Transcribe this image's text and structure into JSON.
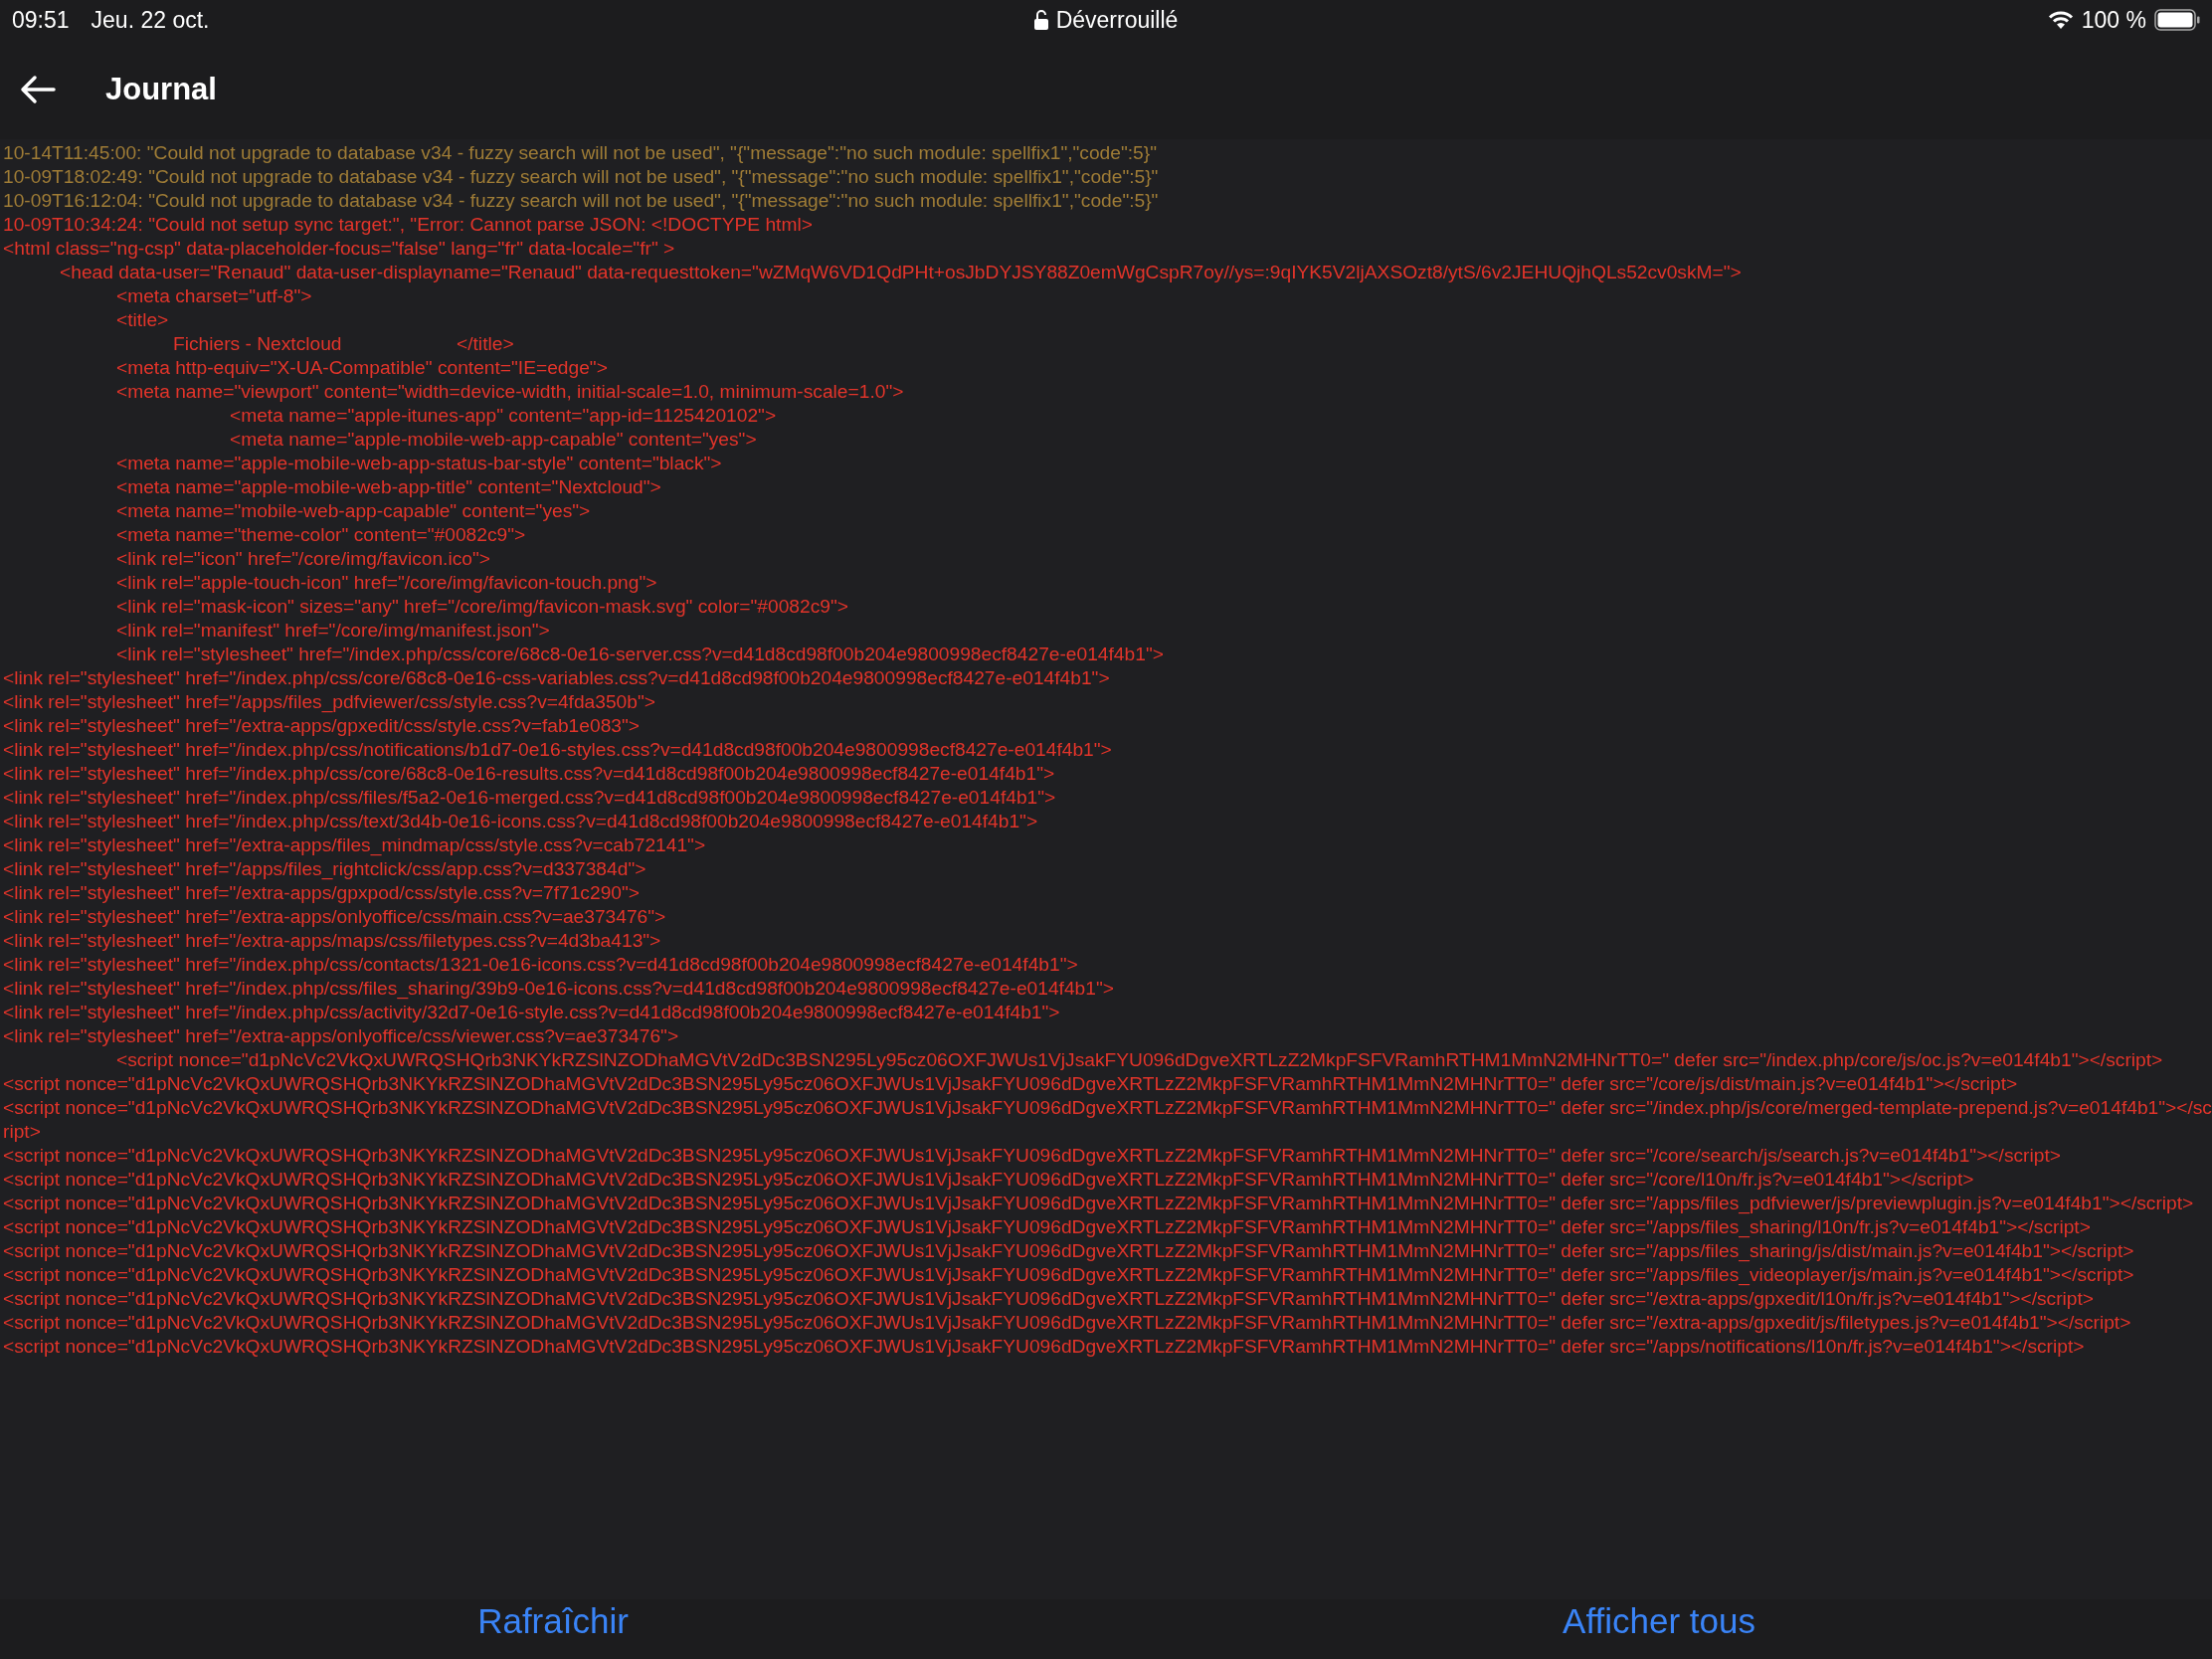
{
  "status_bar": {
    "time": "09:51",
    "date": "Jeu. 22 oct.",
    "lock_label": "Déverrouillé",
    "battery": "100 %"
  },
  "nav": {
    "title": "Journal"
  },
  "log": {
    "lines": [
      {
        "kind": "warning",
        "text": "10-14T11:45:00: \"Could not upgrade to database v34 - fuzzy search will not be used\", \"{\"message\":\"no such module: spellfix1\",\"code\":5}\""
      },
      {
        "kind": "warning",
        "text": "10-09T18:02:49: \"Could not upgrade to database v34 - fuzzy search will not be used\", \"{\"message\":\"no such module: spellfix1\",\"code\":5}\""
      },
      {
        "kind": "warning",
        "text": "10-09T16:12:04: \"Could not upgrade to database v34 - fuzzy search will not be used\", \"{\"message\":\"no such module: spellfix1\",\"code\":5}\""
      },
      {
        "kind": "error",
        "text": "10-09T10:34:24: \"Could not setup sync target:\", \"Error: Cannot parse JSON: <!DOCTYPE html>"
      },
      {
        "kind": "error",
        "text": "<html class=\"ng-csp\" data-placeholder-focus=\"false\" lang=\"fr\" data-locale=\"fr\" >"
      },
      {
        "kind": "error",
        "text": "\t<head data-user=\"Renaud\" data-user-displayname=\"Renaud\" data-requesttoken=\"wZMqW6VD1QdPHt+osJbDYJSY88Z0emWgCspR7oy//ys=:9qIYK5V2ljAXSOzt8/ytS/6v2JEHUQjhQLs52cv0skM=\">"
      },
      {
        "kind": "error",
        "text": "\t\t<meta charset=\"utf-8\">"
      },
      {
        "kind": "error",
        "text": "\t\t<title>"
      },
      {
        "kind": "error",
        "text": "\t\t\tFichiers - Nextcloud\t\t</title>"
      },
      {
        "kind": "error",
        "text": "\t\t<meta http-equiv=\"X-UA-Compatible\" content=\"IE=edge\">"
      },
      {
        "kind": "error",
        "text": "\t\t<meta name=\"viewport\" content=\"width=device-width, initial-scale=1.0, minimum-scale=1.0\">"
      },
      {
        "kind": "error",
        "text": "\t\t\t\t<meta name=\"apple-itunes-app\" content=\"app-id=1125420102\">"
      },
      {
        "kind": "error",
        "text": "\t\t\t\t<meta name=\"apple-mobile-web-app-capable\" content=\"yes\">"
      },
      {
        "kind": "error",
        "text": "\t\t<meta name=\"apple-mobile-web-app-status-bar-style\" content=\"black\">"
      },
      {
        "kind": "error",
        "text": "\t\t<meta name=\"apple-mobile-web-app-title\" content=\"Nextcloud\">"
      },
      {
        "kind": "error",
        "text": "\t\t<meta name=\"mobile-web-app-capable\" content=\"yes\">"
      },
      {
        "kind": "error",
        "text": "\t\t<meta name=\"theme-color\" content=\"#0082c9\">"
      },
      {
        "kind": "error",
        "text": "\t\t<link rel=\"icon\" href=\"/core/img/favicon.ico\">"
      },
      {
        "kind": "error",
        "text": "\t\t<link rel=\"apple-touch-icon\" href=\"/core/img/favicon-touch.png\">"
      },
      {
        "kind": "error",
        "text": "\t\t<link rel=\"mask-icon\" sizes=\"any\" href=\"/core/img/favicon-mask.svg\" color=\"#0082c9\">"
      },
      {
        "kind": "error",
        "text": "\t\t<link rel=\"manifest\" href=\"/core/img/manifest.json\">"
      },
      {
        "kind": "error",
        "text": "\t\t<link rel=\"stylesheet\" href=\"/index.php/css/core/68c8-0e16-server.css?v=d41d8cd98f00b204e9800998ecf8427e-e014f4b1\">"
      },
      {
        "kind": "error",
        "text": "<link rel=\"stylesheet\" href=\"/index.php/css/core/68c8-0e16-css-variables.css?v=d41d8cd98f00b204e9800998ecf8427e-e014f4b1\">"
      },
      {
        "kind": "error",
        "text": "<link rel=\"stylesheet\" href=\"/apps/files_pdfviewer/css/style.css?v=4fda350b\">"
      },
      {
        "kind": "error",
        "text": "<link rel=\"stylesheet\" href=\"/extra-apps/gpxedit/css/style.css?v=fab1e083\">"
      },
      {
        "kind": "error",
        "text": "<link rel=\"stylesheet\" href=\"/index.php/css/notifications/b1d7-0e16-styles.css?v=d41d8cd98f00b204e9800998ecf8427e-e014f4b1\">"
      },
      {
        "kind": "error",
        "text": "<link rel=\"stylesheet\" href=\"/index.php/css/core/68c8-0e16-results.css?v=d41d8cd98f00b204e9800998ecf8427e-e014f4b1\">"
      },
      {
        "kind": "error",
        "text": "<link rel=\"stylesheet\" href=\"/index.php/css/files/f5a2-0e16-merged.css?v=d41d8cd98f00b204e9800998ecf8427e-e014f4b1\">"
      },
      {
        "kind": "error",
        "text": "<link rel=\"stylesheet\" href=\"/index.php/css/text/3d4b-0e16-icons.css?v=d41d8cd98f00b204e9800998ecf8427e-e014f4b1\">"
      },
      {
        "kind": "error",
        "text": "<link rel=\"stylesheet\" href=\"/extra-apps/files_mindmap/css/style.css?v=cab72141\">"
      },
      {
        "kind": "error",
        "text": "<link rel=\"stylesheet\" href=\"/apps/files_rightclick/css/app.css?v=d337384d\">"
      },
      {
        "kind": "error",
        "text": "<link rel=\"stylesheet\" href=\"/extra-apps/gpxpod/css/style.css?v=7f71c290\">"
      },
      {
        "kind": "error",
        "text": "<link rel=\"stylesheet\" href=\"/extra-apps/onlyoffice/css/main.css?v=ae373476\">"
      },
      {
        "kind": "error",
        "text": "<link rel=\"stylesheet\" href=\"/extra-apps/maps/css/filetypes.css?v=4d3ba413\">"
      },
      {
        "kind": "error",
        "text": "<link rel=\"stylesheet\" href=\"/index.php/css/contacts/1321-0e16-icons.css?v=d41d8cd98f00b204e9800998ecf8427e-e014f4b1\">"
      },
      {
        "kind": "error",
        "text": "<link rel=\"stylesheet\" href=\"/index.php/css/files_sharing/39b9-0e16-icons.css?v=d41d8cd98f00b204e9800998ecf8427e-e014f4b1\">"
      },
      {
        "kind": "error",
        "text": "<link rel=\"stylesheet\" href=\"/index.php/css/activity/32d7-0e16-style.css?v=d41d8cd98f00b204e9800998ecf8427e-e014f4b1\">"
      },
      {
        "kind": "error",
        "text": "<link rel=\"stylesheet\" href=\"/extra-apps/onlyoffice/css/viewer.css?v=ae373476\">"
      },
      {
        "kind": "error",
        "text": "\t\t<script nonce=\"d1pNcVc2VkQxUWRQSHQrb3NKYkRZSlNZODhaMGVtV2dDc3BSN295Ly95cz06OXFJWUs1VjJsakFYU096dDgveXRTLzZ2MkpFSFVRamhRTHM1MmN2MHNrTT0=\" defer src=\"/index.php/core/js/oc.js?v=e014f4b1\"></script>"
      },
      {
        "kind": "error",
        "text": "<script nonce=\"d1pNcVc2VkQxUWRQSHQrb3NKYkRZSlNZODhaMGVtV2dDc3BSN295Ly95cz06OXFJWUs1VjJsakFYU096dDgveXRTLzZ2MkpFSFVRamhRTHM1MmN2MHNrTT0=\" defer src=\"/core/js/dist/main.js?v=e014f4b1\"></script>"
      },
      {
        "kind": "error",
        "text": "<script nonce=\"d1pNcVc2VkQxUWRQSHQrb3NKYkRZSlNZODhaMGVtV2dDc3BSN295Ly95cz06OXFJWUs1VjJsakFYU096dDgveXRTLzZ2MkpFSFVRamhRTHM1MmN2MHNrTT0=\" defer src=\"/index.php/js/core/merged-template-prepend.js?v=e014f4b1\"></script>"
      },
      {
        "kind": "error",
        "text": "<script nonce=\"d1pNcVc2VkQxUWRQSHQrb3NKYkRZSlNZODhaMGVtV2dDc3BSN295Ly95cz06OXFJWUs1VjJsakFYU096dDgveXRTLzZ2MkpFSFVRamhRTHM1MmN2MHNrTT0=\" defer src=\"/core/search/js/search.js?v=e014f4b1\"></script>"
      },
      {
        "kind": "error",
        "text": "<script nonce=\"d1pNcVc2VkQxUWRQSHQrb3NKYkRZSlNZODhaMGVtV2dDc3BSN295Ly95cz06OXFJWUs1VjJsakFYU096dDgveXRTLzZ2MkpFSFVRamhRTHM1MmN2MHNrTT0=\" defer src=\"/core/l10n/fr.js?v=e014f4b1\"></script>"
      },
      {
        "kind": "error",
        "text": "<script nonce=\"d1pNcVc2VkQxUWRQSHQrb3NKYkRZSlNZODhaMGVtV2dDc3BSN295Ly95cz06OXFJWUs1VjJsakFYU096dDgveXRTLzZ2MkpFSFVRamhRTHM1MmN2MHNrTT0=\" defer src=\"/apps/files_pdfviewer/js/previewplugin.js?v=e014f4b1\"></script>"
      },
      {
        "kind": "error",
        "text": "<script nonce=\"d1pNcVc2VkQxUWRQSHQrb3NKYkRZSlNZODhaMGVtV2dDc3BSN295Ly95cz06OXFJWUs1VjJsakFYU096dDgveXRTLzZ2MkpFSFVRamhRTHM1MmN2MHNrTT0=\" defer src=\"/apps/files_sharing/l10n/fr.js?v=e014f4b1\"></script>"
      },
      {
        "kind": "error",
        "text": "<script nonce=\"d1pNcVc2VkQxUWRQSHQrb3NKYkRZSlNZODhaMGVtV2dDc3BSN295Ly95cz06OXFJWUs1VjJsakFYU096dDgveXRTLzZ2MkpFSFVRamhRTHM1MmN2MHNrTT0=\" defer src=\"/apps/files_sharing/js/dist/main.js?v=e014f4b1\"></script>"
      },
      {
        "kind": "error",
        "text": "<script nonce=\"d1pNcVc2VkQxUWRQSHQrb3NKYkRZSlNZODhaMGVtV2dDc3BSN295Ly95cz06OXFJWUs1VjJsakFYU096dDgveXRTLzZ2MkpFSFVRamhRTHM1MmN2MHNrTT0=\" defer src=\"/apps/files_videoplayer/js/main.js?v=e014f4b1\"></script>"
      },
      {
        "kind": "error",
        "text": "<script nonce=\"d1pNcVc2VkQxUWRQSHQrb3NKYkRZSlNZODhaMGVtV2dDc3BSN295Ly95cz06OXFJWUs1VjJsakFYU096dDgveXRTLzZ2MkpFSFVRamhRTHM1MmN2MHNrTT0=\" defer src=\"/extra-apps/gpxedit/l10n/fr.js?v=e014f4b1\"></script>"
      },
      {
        "kind": "error",
        "text": "<script nonce=\"d1pNcVc2VkQxUWRQSHQrb3NKYkRZSlNZODhaMGVtV2dDc3BSN295Ly95cz06OXFJWUs1VjJsakFYU096dDgveXRTLzZ2MkpFSFVRamhRTHM1MmN2MHNrTT0=\" defer src=\"/extra-apps/gpxedit/js/filetypes.js?v=e014f4b1\"></script>"
      },
      {
        "kind": "error",
        "text": "<script nonce=\"d1pNcVc2VkQxUWRQSHQrb3NKYkRZSlNZODhaMGVtV2dDc3BSN295Ly95cz06OXFJWUs1VjJsakFYU096dDgveXRTLzZ2MkpFSFVRamhRTHM1MmN2MHNrTT0=\" defer src=\"/apps/notifications/l10n/fr.js?v=e014f4b1\"></script>"
      }
    ]
  },
  "toolbar": {
    "buttons": [
      "Rafraîchir",
      "Afficher tous"
    ]
  }
}
